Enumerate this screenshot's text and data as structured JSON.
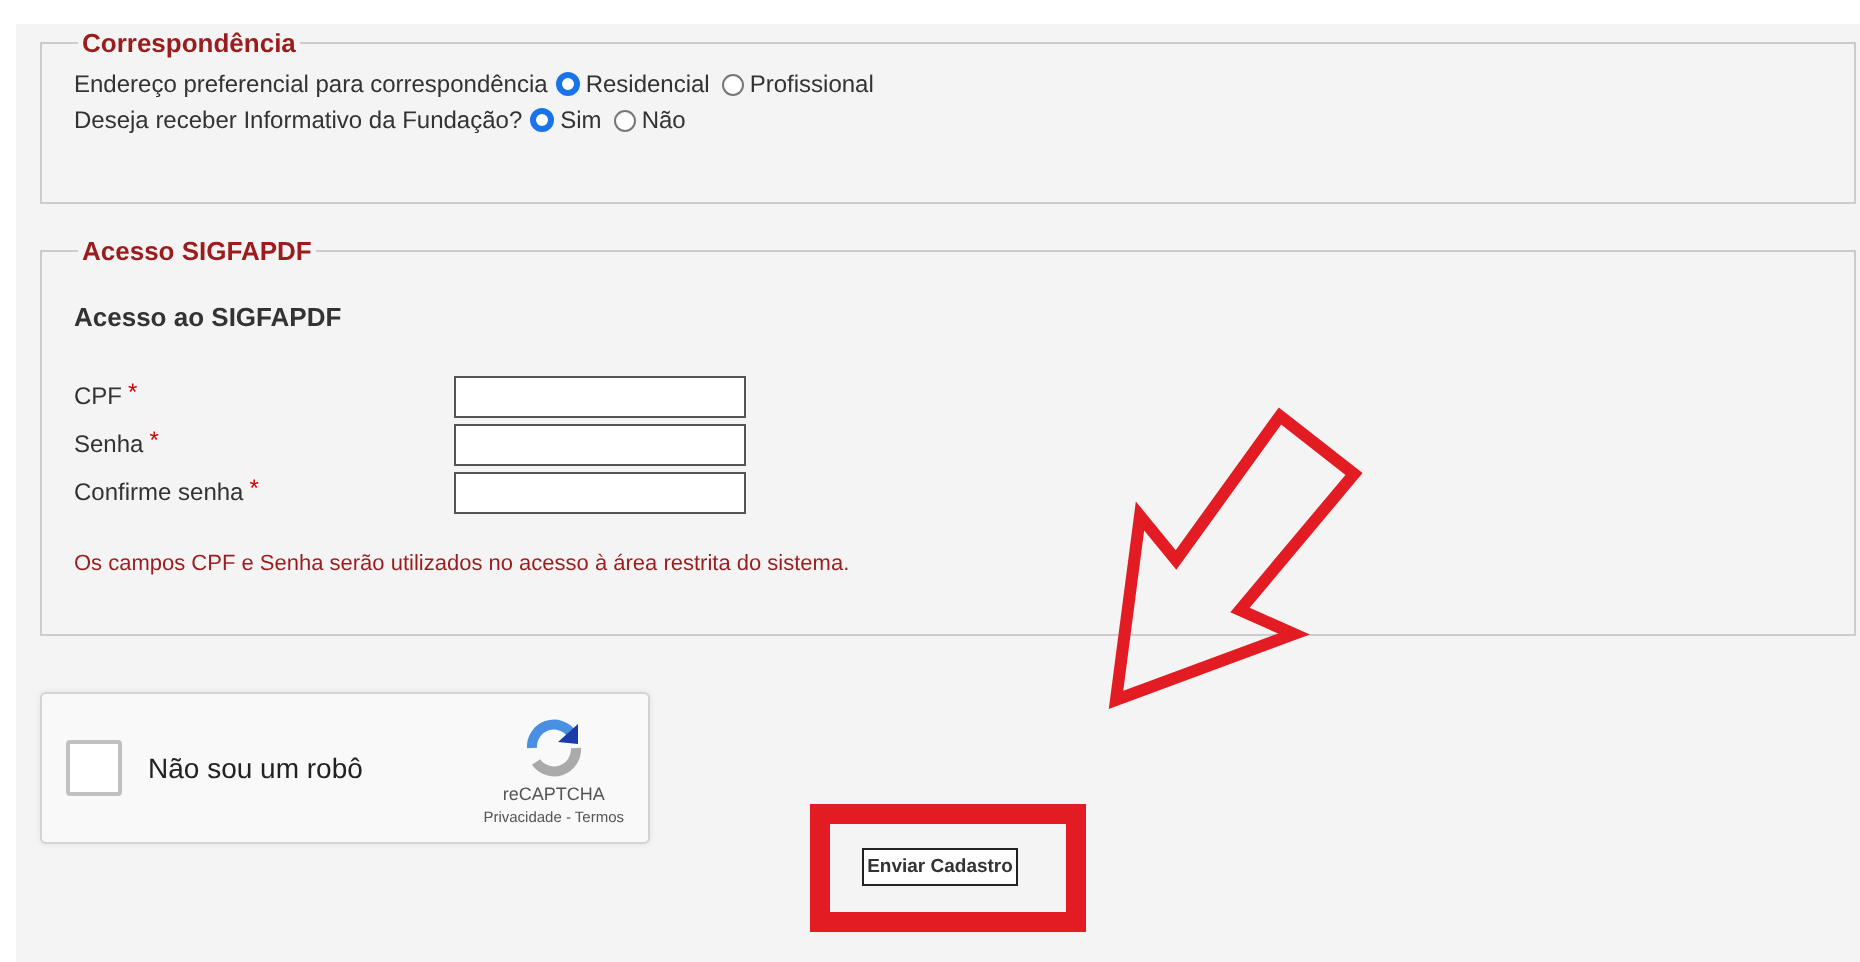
{
  "correspondence": {
    "legend": "Correspondência",
    "radio_groups": [
      {
        "label": "Endereço preferencial para correspondência",
        "options": [
          {
            "label": "Residencial",
            "selected": true
          },
          {
            "label": "Profissional",
            "selected": false
          }
        ]
      },
      {
        "label": "Deseja receber Informativo da Fundação?",
        "options": [
          {
            "label": "Sim",
            "selected": true
          },
          {
            "label": "Não",
            "selected": false
          }
        ]
      }
    ]
  },
  "access": {
    "legend": "Acesso SIGFAPDF",
    "heading": "Acesso ao SIGFAPDF",
    "fields": [
      {
        "label": "CPF",
        "required_mark": "*"
      },
      {
        "label": "Senha",
        "required_mark": "*"
      },
      {
        "label": "Confirme senha",
        "required_mark": "*"
      }
    ],
    "note": "Os campos CPF e Senha serão utilizados no acesso à área restrita do sistema."
  },
  "captcha": {
    "label": "Não sou um robô",
    "checked": false,
    "brand": "reCAPTCHA",
    "links": "Privacidade - Termos"
  },
  "submit_button": "Enviar Cadastro"
}
